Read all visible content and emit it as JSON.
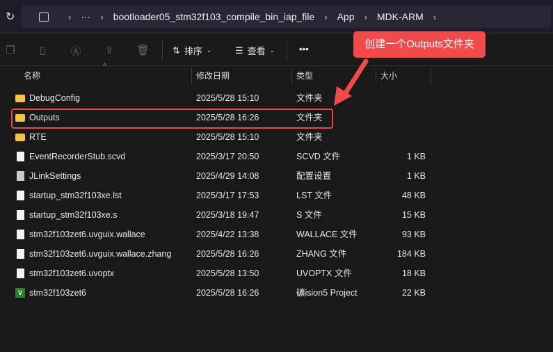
{
  "breadcrumb": {
    "items": [
      "bootloader05_stm32f103_compile_bin_iap_file",
      "App",
      "MDK-ARM"
    ],
    "more": "···"
  },
  "toolbar": {
    "sort": "排序",
    "view": "查看",
    "more": "•••"
  },
  "columns": {
    "name": "名称",
    "date": "修改日期",
    "type": "类型",
    "size": "大小"
  },
  "files": [
    {
      "name": "DebugConfig",
      "date": "2025/5/28 15:10",
      "type": "文件夹",
      "size": "",
      "icon": "folder"
    },
    {
      "name": "Outputs",
      "date": "2025/5/28 16:26",
      "type": "文件夹",
      "size": "",
      "icon": "folder"
    },
    {
      "name": "RTE",
      "date": "2025/5/28 15:10",
      "type": "文件夹",
      "size": "",
      "icon": "folder"
    },
    {
      "name": "EventRecorderStub.scvd",
      "date": "2025/3/17 20:50",
      "type": "SCVD 文件",
      "size": "1 KB",
      "icon": "file"
    },
    {
      "name": "JLinkSettings",
      "date": "2025/4/29 14:08",
      "type": "配置设置",
      "size": "1 KB",
      "icon": "cfg"
    },
    {
      "name": "startup_stm32f103xe.lst",
      "date": "2025/3/17 17:53",
      "type": "LST 文件",
      "size": "48 KB",
      "icon": "file"
    },
    {
      "name": "startup_stm32f103xe.s",
      "date": "2025/3/18 19:47",
      "type": "S 文件",
      "size": "15 KB",
      "icon": "file"
    },
    {
      "name": "stm32f103zet6.uvguix.wallace",
      "date": "2025/4/22 13:38",
      "type": "WALLACE 文件",
      "size": "93 KB",
      "icon": "file"
    },
    {
      "name": "stm32f103zet6.uvguix.wallace.zhang",
      "date": "2025/5/28 16:26",
      "type": "ZHANG 文件",
      "size": "184 KB",
      "icon": "file"
    },
    {
      "name": "stm32f103zet6.uvoptx",
      "date": "2025/5/28 13:50",
      "type": "UVOPTX 文件",
      "size": "18 KB",
      "icon": "file"
    },
    {
      "name": "stm32f103zet6",
      "date": "2025/5/28 16:26",
      "type": "礦ision5 Project",
      "size": "22 KB",
      "icon": "uv"
    }
  ],
  "annotation": {
    "text": "创建一个Outputs文件夹",
    "color": "#f24a4a"
  }
}
